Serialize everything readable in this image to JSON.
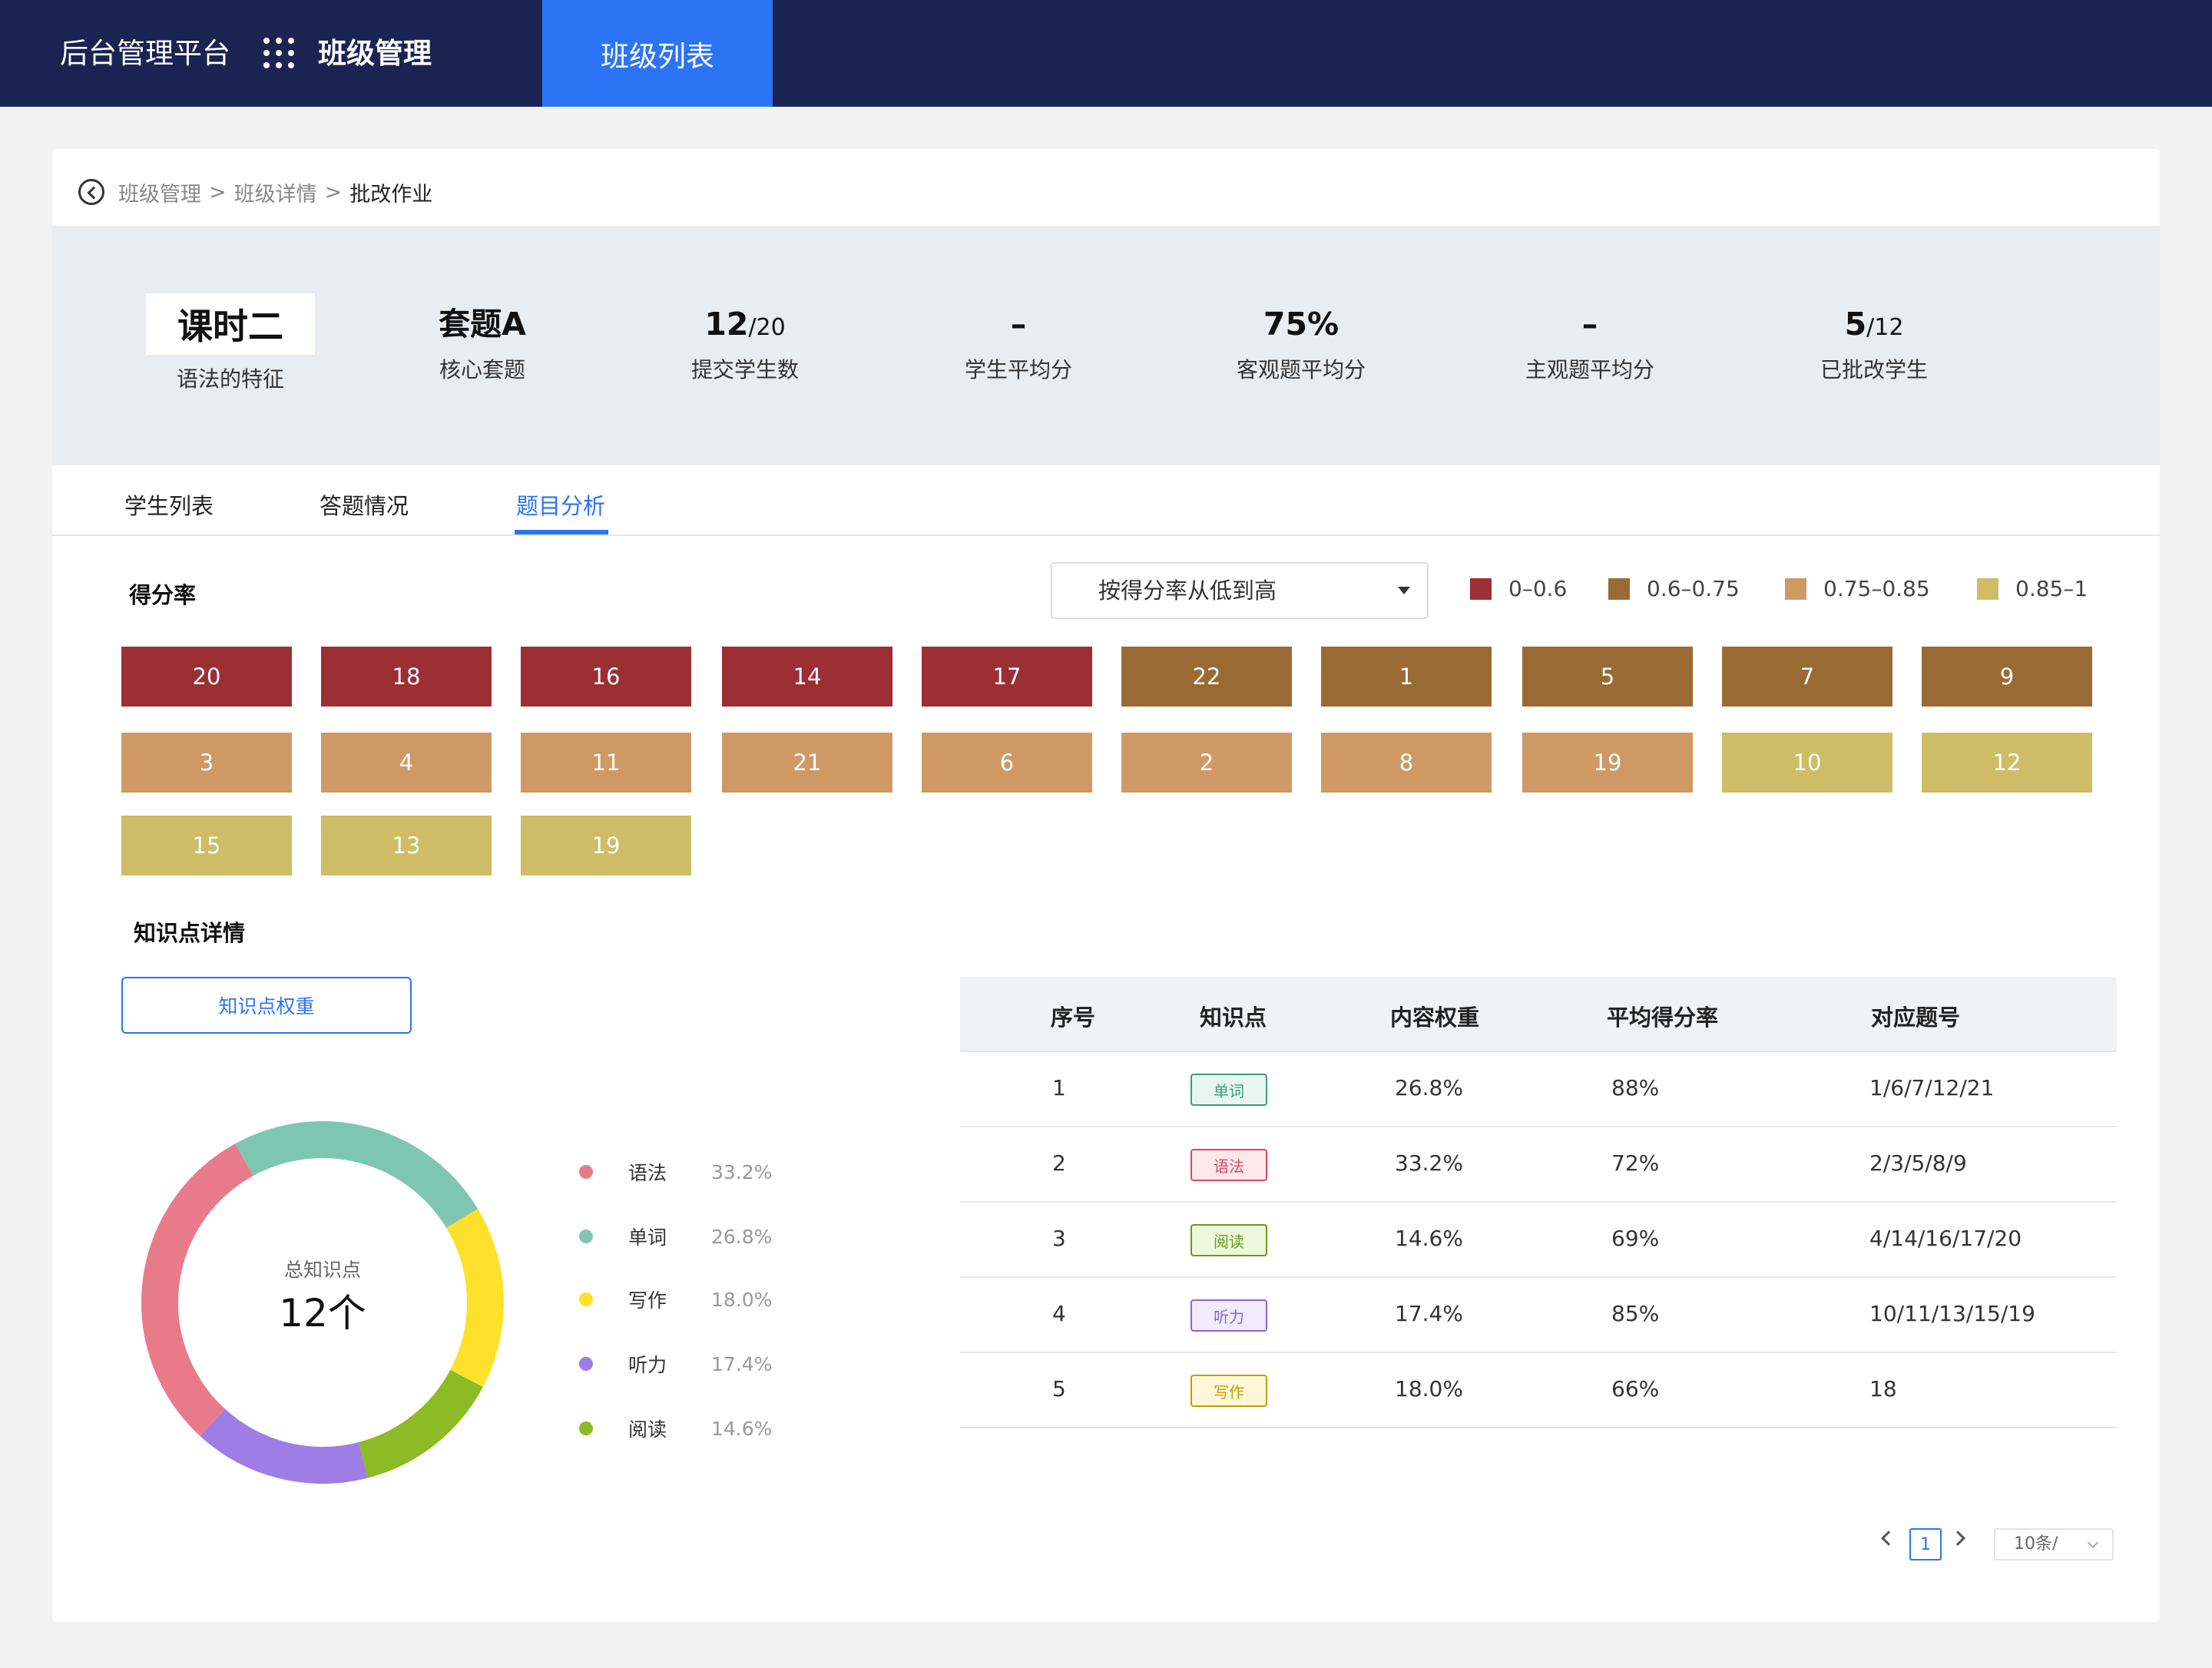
{
  "topbar": {
    "brand": "后台管理平台",
    "module": "班级管理",
    "active_tab": "班级列表",
    "bg_color": "#1a2352",
    "accent_color": "#2b74f5"
  },
  "breadcrumb": {
    "items": [
      "班级管理",
      "班级详情"
    ],
    "current": "批改作业",
    "separator": ">"
  },
  "summary": {
    "lesson_title": "课时二",
    "lesson_subtitle": "语法的特征",
    "stats": [
      {
        "value": "套题A",
        "small": "",
        "label": "核心套题"
      },
      {
        "value": "12",
        "small": "/20",
        "label": "提交学生数"
      },
      {
        "value": "–",
        "small": "",
        "label": "学生平均分"
      },
      {
        "value": "75%",
        "small": "",
        "label": "客观题平均分"
      },
      {
        "value": "–",
        "small": "",
        "label": "主观题平均分"
      },
      {
        "value": "5",
        "small": "/12",
        "label": "已批改学生"
      }
    ]
  },
  "tabs": {
    "student_list": "学生列表",
    "answers": "答题情况",
    "analysis": "题目分析",
    "active": "analysis"
  },
  "score_rate": {
    "title": "得分率",
    "sort_label": "按得分率从低到高",
    "legend": [
      {
        "label": "0–0.6",
        "color": "#9b2f34"
      },
      {
        "label": "0.6–0.75",
        "color": "#9a6a34"
      },
      {
        "label": "0.75–0.85",
        "color": "#cf9966"
      },
      {
        "label": "0.85–1",
        "color": "#cfbc66"
      }
    ],
    "rows": [
      [
        {
          "n": "20",
          "c": 0
        },
        {
          "n": "18",
          "c": 0
        },
        {
          "n": "16",
          "c": 0
        },
        {
          "n": "14",
          "c": 0
        },
        {
          "n": "17",
          "c": 0
        },
        {
          "n": "22",
          "c": 1
        },
        {
          "n": "1",
          "c": 1
        },
        {
          "n": "5",
          "c": 1
        },
        {
          "n": "7",
          "c": 1
        },
        {
          "n": "9",
          "c": 1
        }
      ],
      [
        {
          "n": "3",
          "c": 2
        },
        {
          "n": "4",
          "c": 2
        },
        {
          "n": "11",
          "c": 2
        },
        {
          "n": "21",
          "c": 2
        },
        {
          "n": "6",
          "c": 2
        },
        {
          "n": "2",
          "c": 2
        },
        {
          "n": "8",
          "c": 2
        },
        {
          "n": "19",
          "c": 2
        },
        {
          "n": "10",
          "c": 3
        },
        {
          "n": "12",
          "c": 3
        }
      ],
      [
        {
          "n": "15",
          "c": 3
        },
        {
          "n": "13",
          "c": 3
        },
        {
          "n": "19",
          "c": 3
        }
      ]
    ]
  },
  "knowledge": {
    "title": "知识点详情",
    "weight_button": "知识点权重",
    "center_label": "总知识点",
    "center_value": "12个",
    "segments": [
      {
        "name": "语法",
        "pct": "33.2%",
        "value": 33.2,
        "color": "#e87b8a"
      },
      {
        "name": "单词",
        "pct": "26.8%",
        "value": 26.8,
        "color": "#7fc6b1"
      },
      {
        "name": "写作",
        "pct": "18.0%",
        "value": 18.0,
        "color": "#fde12a"
      },
      {
        "name": "听力",
        "pct": "17.4%",
        "value": 17.4,
        "color": "#9e7de6"
      },
      {
        "name": "阅读",
        "pct": "14.6%",
        "value": 14.6,
        "color": "#8cbb25"
      }
    ]
  },
  "table": {
    "headers": [
      "序号",
      "知识点",
      "内容权重",
      "平均得分率",
      "对应题号"
    ],
    "rows": [
      {
        "no": "1",
        "tag": "单词",
        "tag_color": "#3a9c7e",
        "tag_bg": "#e7f6f0",
        "weight": "26.8%",
        "rate": "88%",
        "questions": "1/6/7/12/21"
      },
      {
        "no": "2",
        "tag": "语法",
        "tag_color": "#e0485f",
        "tag_bg": "#fde9ec",
        "weight": "33.2%",
        "rate": "72%",
        "questions": "2/3/5/8/9"
      },
      {
        "no": "3",
        "tag": "阅读",
        "tag_color": "#6a9a17",
        "tag_bg": "#eef7dc",
        "weight": "14.6%",
        "rate": "69%",
        "questions": "4/14/16/17/20"
      },
      {
        "no": "4",
        "tag": "听力",
        "tag_color": "#8a66d6",
        "tag_bg": "#f1ebfd",
        "weight": "17.4%",
        "rate": "85%",
        "questions": "10/11/13/15/19"
      },
      {
        "no": "5",
        "tag": "写作",
        "tag_color": "#c79a00",
        "tag_bg": "#fff8d6",
        "weight": "18.0%",
        "rate": "66%",
        "questions": "18"
      }
    ]
  },
  "pager": {
    "current_page": "1",
    "page_size": "10条/"
  }
}
